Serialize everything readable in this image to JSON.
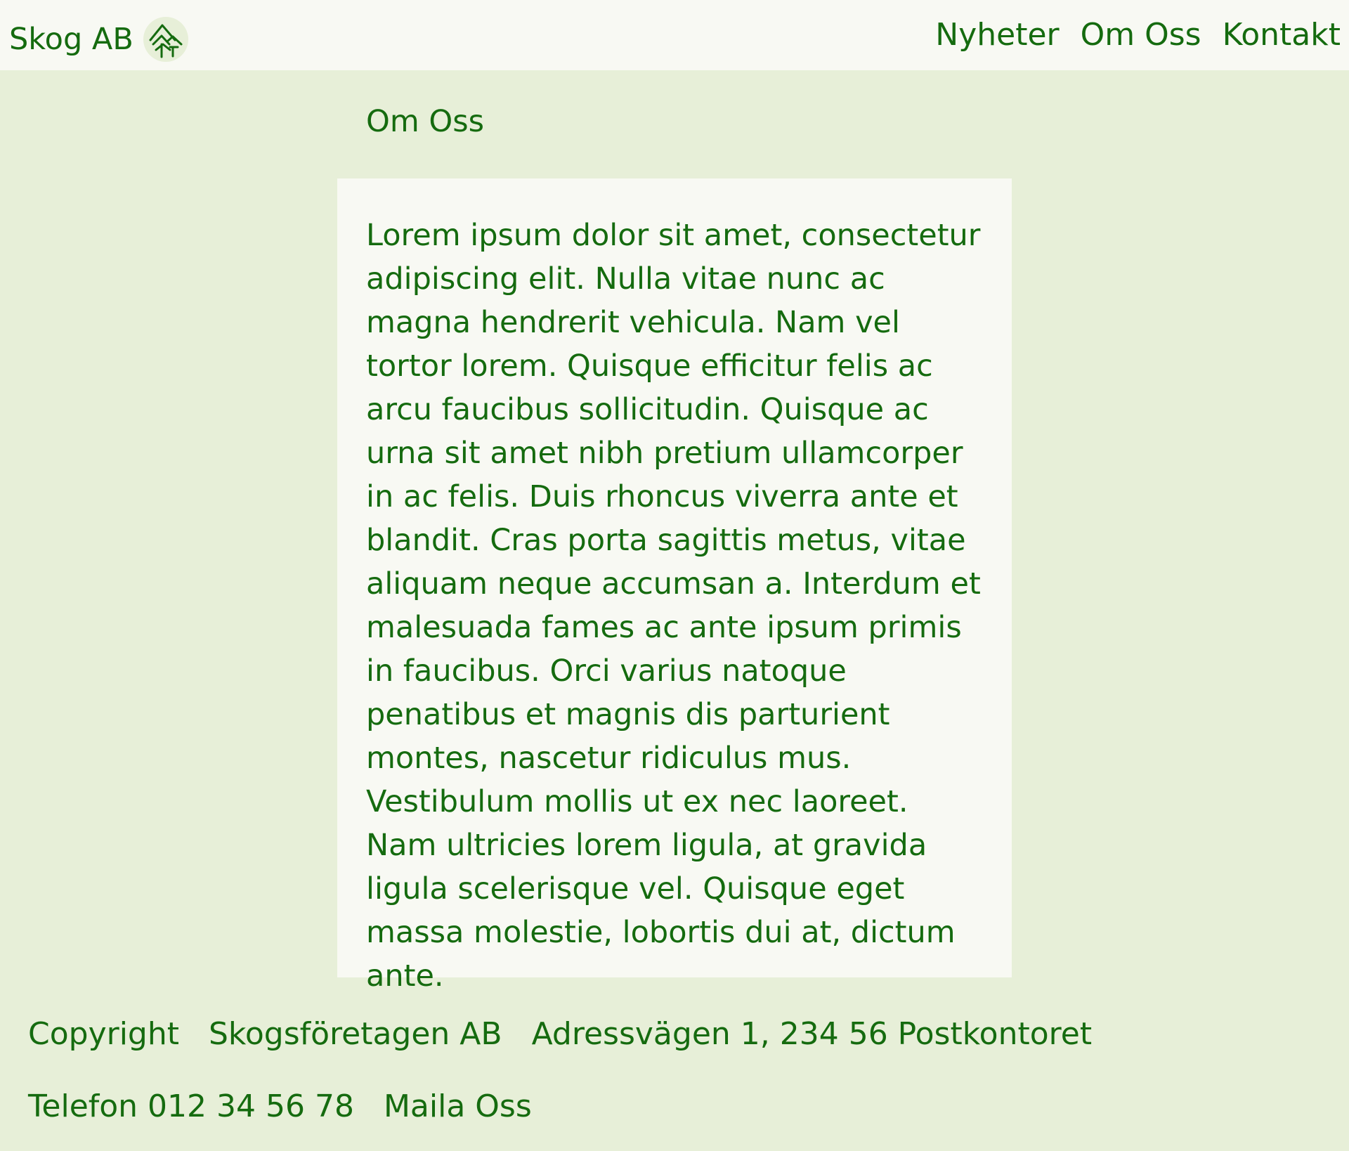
{
  "header": {
    "brand": "Skog AB",
    "logo_icon": "forest-trees-icon",
    "nav": [
      "Nyheter",
      "Om Oss",
      "Kontakt"
    ]
  },
  "main": {
    "heading": "Om Oss",
    "body": "Lorem ipsum dolor sit amet, consectetur adipiscing elit. Nulla vitae nunc ac magna hendrerit vehicula. Nam vel tortor lorem. Quisque efficitur felis ac arcu faucibus sollicitudin. Quisque ac urna sit amet nibh pretium ullamcorper in ac felis. Duis rhoncus viverra ante et blandit. Cras porta sagittis metus, vitae aliquam neque accumsan a. Interdum et malesuada fames ac ante ipsum primis in faucibus. Orci varius natoque penatibus et magnis dis parturient montes, nascetur ridiculus mus. Vestibulum mollis ut ex nec laoreet. Nam ultricies lorem ligula, at gravida ligula scelerisque vel. Quisque eget massa molestie, lobortis dui at, dictum ante."
  },
  "footer": {
    "copyright": "Copyright",
    "company": "Skogsföretagen AB",
    "address": "Adressvägen 1, 234 56 Postkontoret",
    "phone": "Telefon 012 34 56 78",
    "email_link": "Maila Oss"
  },
  "colors": {
    "accent_green": "#156b0f",
    "background": "#e7efd8",
    "surface": "#f8f9f3"
  }
}
